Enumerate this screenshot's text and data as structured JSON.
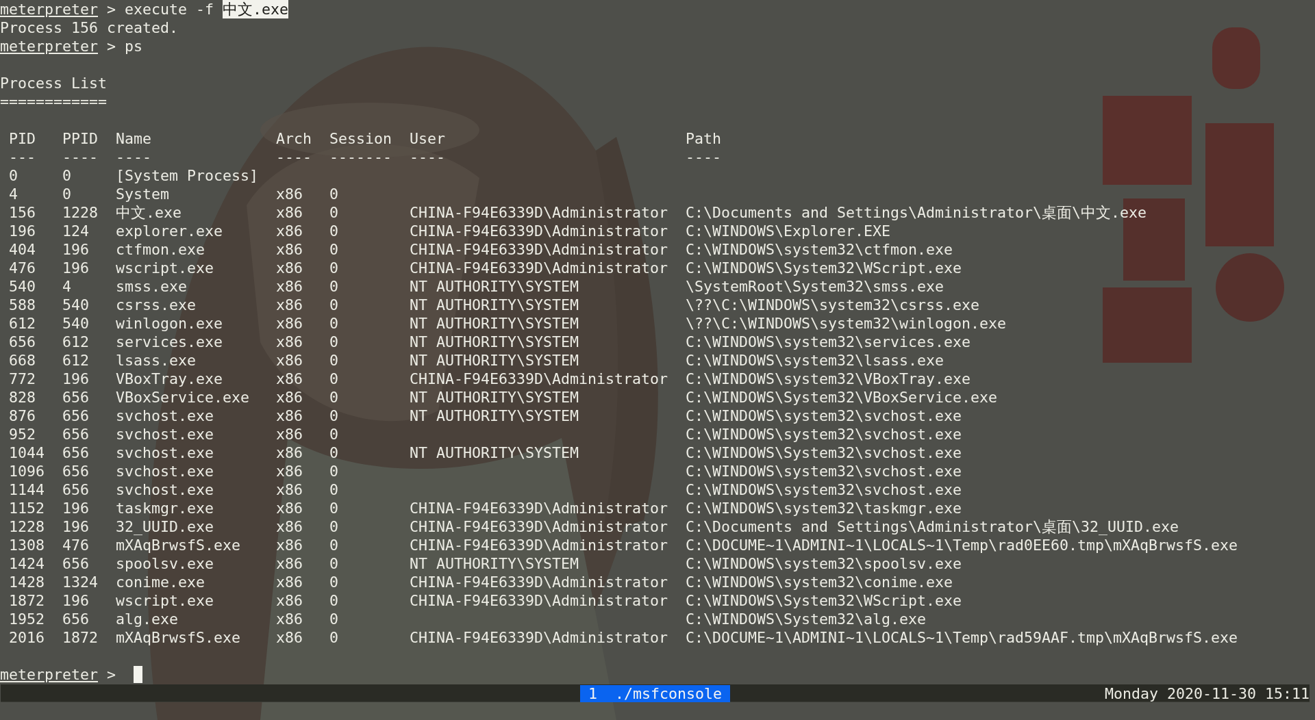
{
  "terminal": {
    "history": [
      {
        "kind": "command",
        "prompt": "meterpreter",
        "separator": ">",
        "segments": [
          {
            "text": "execute -f",
            "highlighted": false
          },
          {
            "text": "中文.exe",
            "highlighted": true
          }
        ]
      },
      {
        "kind": "output",
        "text": "Process 156 created."
      },
      {
        "kind": "command",
        "prompt": "meterpreter",
        "separator": ">",
        "segments": [
          {
            "text": "ps",
            "highlighted": false
          }
        ]
      }
    ],
    "process_list": {
      "title": "Process List",
      "title_rule": "============",
      "columns": [
        {
          "label": "PID",
          "rule": "---"
        },
        {
          "label": "PPID",
          "rule": "----"
        },
        {
          "label": "Name",
          "rule": "----"
        },
        {
          "label": "Arch",
          "rule": "----"
        },
        {
          "label": "Session",
          "rule": "-------"
        },
        {
          "label": "User",
          "rule": "----"
        },
        {
          "label": "Path",
          "rule": "----"
        }
      ],
      "rows": [
        {
          "pid": "0",
          "ppid": "0",
          "name": "[System Process]"
        },
        {
          "pid": "4",
          "ppid": "0",
          "name": "System",
          "arch": "x86",
          "session": "0"
        },
        {
          "pid": "156",
          "ppid": "1228",
          "name": "中文.exe",
          "arch": "x86",
          "session": "0",
          "user": "CHINA-F94E6339D\\Administrator",
          "path": "C:\\Documents and Settings\\Administrator\\桌面\\中文.exe"
        },
        {
          "pid": "196",
          "ppid": "124",
          "name": "explorer.exe",
          "arch": "x86",
          "session": "0",
          "user": "CHINA-F94E6339D\\Administrator",
          "path": "C:\\WINDOWS\\Explorer.EXE"
        },
        {
          "pid": "404",
          "ppid": "196",
          "name": "ctfmon.exe",
          "arch": "x86",
          "session": "0",
          "user": "CHINA-F94E6339D\\Administrator",
          "path": "C:\\WINDOWS\\system32\\ctfmon.exe"
        },
        {
          "pid": "476",
          "ppid": "196",
          "name": "wscript.exe",
          "arch": "x86",
          "session": "0",
          "user": "CHINA-F94E6339D\\Administrator",
          "path": "C:\\WINDOWS\\System32\\WScript.exe"
        },
        {
          "pid": "540",
          "ppid": "4",
          "name": "smss.exe",
          "arch": "x86",
          "session": "0",
          "user": "NT AUTHORITY\\SYSTEM",
          "path": "\\SystemRoot\\System32\\smss.exe"
        },
        {
          "pid": "588",
          "ppid": "540",
          "name": "csrss.exe",
          "arch": "x86",
          "session": "0",
          "user": "NT AUTHORITY\\SYSTEM",
          "path": "\\??\\C:\\WINDOWS\\system32\\csrss.exe"
        },
        {
          "pid": "612",
          "ppid": "540",
          "name": "winlogon.exe",
          "arch": "x86",
          "session": "0",
          "user": "NT AUTHORITY\\SYSTEM",
          "path": "\\??\\C:\\WINDOWS\\system32\\winlogon.exe"
        },
        {
          "pid": "656",
          "ppid": "612",
          "name": "services.exe",
          "arch": "x86",
          "session": "0",
          "user": "NT AUTHORITY\\SYSTEM",
          "path": "C:\\WINDOWS\\system32\\services.exe"
        },
        {
          "pid": "668",
          "ppid": "612",
          "name": "lsass.exe",
          "arch": "x86",
          "session": "0",
          "user": "NT AUTHORITY\\SYSTEM",
          "path": "C:\\WINDOWS\\system32\\lsass.exe"
        },
        {
          "pid": "772",
          "ppid": "196",
          "name": "VBoxTray.exe",
          "arch": "x86",
          "session": "0",
          "user": "CHINA-F94E6339D\\Administrator",
          "path": "C:\\WINDOWS\\system32\\VBoxTray.exe"
        },
        {
          "pid": "828",
          "ppid": "656",
          "name": "VBoxService.exe",
          "arch": "x86",
          "session": "0",
          "user": "NT AUTHORITY\\SYSTEM",
          "path": "C:\\WINDOWS\\System32\\VBoxService.exe"
        },
        {
          "pid": "876",
          "ppid": "656",
          "name": "svchost.exe",
          "arch": "x86",
          "session": "0",
          "user": "NT AUTHORITY\\SYSTEM",
          "path": "C:\\WINDOWS\\system32\\svchost.exe"
        },
        {
          "pid": "952",
          "ppid": "656",
          "name": "svchost.exe",
          "arch": "x86",
          "session": "0",
          "path": "C:\\WINDOWS\\system32\\svchost.exe"
        },
        {
          "pid": "1044",
          "ppid": "656",
          "name": "svchost.exe",
          "arch": "x86",
          "session": "0",
          "user": "NT AUTHORITY\\SYSTEM",
          "path": "C:\\WINDOWS\\System32\\svchost.exe"
        },
        {
          "pid": "1096",
          "ppid": "656",
          "name": "svchost.exe",
          "arch": "x86",
          "session": "0",
          "path": "C:\\WINDOWS\\system32\\svchost.exe"
        },
        {
          "pid": "1144",
          "ppid": "656",
          "name": "svchost.exe",
          "arch": "x86",
          "session": "0",
          "path": "C:\\WINDOWS\\system32\\svchost.exe"
        },
        {
          "pid": "1152",
          "ppid": "196",
          "name": "taskmgr.exe",
          "arch": "x86",
          "session": "0",
          "user": "CHINA-F94E6339D\\Administrator",
          "path": "C:\\WINDOWS\\system32\\taskmgr.exe"
        },
        {
          "pid": "1228",
          "ppid": "196",
          "name": "32_UUID.exe",
          "arch": "x86",
          "session": "0",
          "user": "CHINA-F94E6339D\\Administrator",
          "path": "C:\\Documents and Settings\\Administrator\\桌面\\32_UUID.exe"
        },
        {
          "pid": "1308",
          "ppid": "476",
          "name": "mXAqBrwsfS.exe",
          "arch": "x86",
          "session": "0",
          "user": "CHINA-F94E6339D\\Administrator",
          "path": "C:\\DOCUME~1\\ADMINI~1\\LOCALS~1\\Temp\\rad0EE60.tmp\\mXAqBrwsfS.exe"
        },
        {
          "pid": "1424",
          "ppid": "656",
          "name": "spoolsv.exe",
          "arch": "x86",
          "session": "0",
          "user": "NT AUTHORITY\\SYSTEM",
          "path": "C:\\WINDOWS\\system32\\spoolsv.exe"
        },
        {
          "pid": "1428",
          "ppid": "1324",
          "name": "conime.exe",
          "arch": "x86",
          "session": "0",
          "user": "CHINA-F94E6339D\\Administrator",
          "path": "C:\\WINDOWS\\system32\\conime.exe"
        },
        {
          "pid": "1872",
          "ppid": "196",
          "name": "wscript.exe",
          "arch": "x86",
          "session": "0",
          "user": "CHINA-F94E6339D\\Administrator",
          "path": "C:\\WINDOWS\\System32\\WScript.exe"
        },
        {
          "pid": "1952",
          "ppid": "656",
          "name": "alg.exe",
          "arch": "x86",
          "session": "0",
          "path": "C:\\WINDOWS\\System32\\alg.exe"
        },
        {
          "pid": "2016",
          "ppid": "1872",
          "name": "mXAqBrwsfS.exe",
          "arch": "x86",
          "session": "0",
          "user": "CHINA-F94E6339D\\Administrator",
          "path": "C:\\DOCUME~1\\ADMINI~1\\LOCALS~1\\Temp\\rad59AAF.tmp\\mXAqBrwsfS.exe"
        }
      ]
    },
    "prompt": {
      "prompt": "meterpreter",
      "separator": ">"
    }
  },
  "status_bar": {
    "windows": [
      {
        "index": "1",
        "name": "./msfconsole",
        "selected": true
      }
    ],
    "clock": "Monday 2020-11-30 15:11"
  }
}
